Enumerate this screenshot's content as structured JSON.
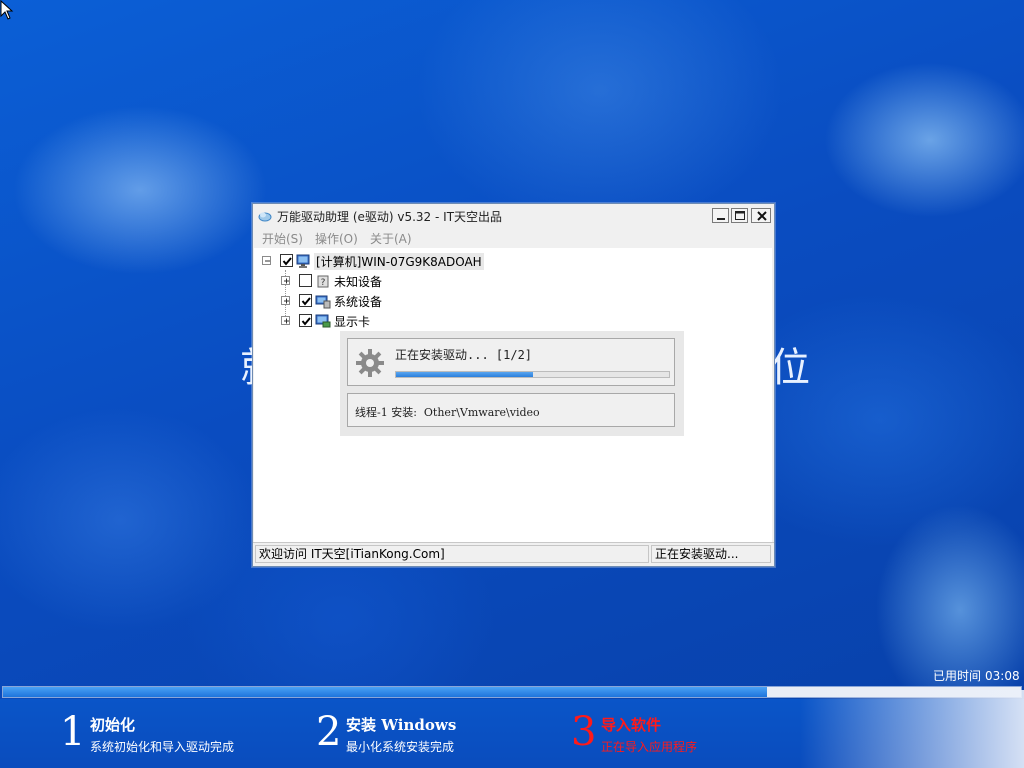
{
  "desktop": {
    "heading_left_fragment": "就",
    "heading_right_fragment": "位"
  },
  "window": {
    "title": "万能驱动助理 (e驱动) v5.32 - IT天空出品",
    "menu": [
      "开始(S)",
      "操作(O)",
      "关于(A)"
    ],
    "tree": {
      "root": {
        "label": "[计算机]WIN-07G9K8ADOAH",
        "checked": true
      },
      "children": [
        {
          "label": "未知设备",
          "checked": false
        },
        {
          "label": "系统设备",
          "checked": true
        },
        {
          "label": "显示卡",
          "checked": true
        }
      ]
    },
    "progress": {
      "text": "正在安装驱动... [1/2]",
      "fraction": 0.5,
      "thread_text": "线程-1 安装:  Other\\Vmware\\video"
    },
    "status": {
      "left": "欢迎访问 IT天空[iTianKong.Com]",
      "right": "正在安装驱动..."
    }
  },
  "install": {
    "elapsed_label": "已用时间",
    "elapsed_time": "03:08",
    "overall_fraction": 0.75,
    "steps": [
      {
        "num": "1",
        "title": "初始化",
        "subtitle": "系统初始化和导入驱动完成"
      },
      {
        "num": "2",
        "title": "安装 Windows",
        "subtitle": "最小化系统安装完成"
      },
      {
        "num": "3",
        "title": "导入软件",
        "subtitle": "正在导入应用程序"
      }
    ],
    "active_color": "#ff1a1a"
  },
  "icons": {
    "app": "cloud-icon",
    "gear": "gear-icon",
    "computer": "computer-icon",
    "unknown_device": "unknown-device-icon",
    "system_device": "system-device-icon",
    "display_card": "display-card-icon",
    "cursor": "mouse-cursor-icon"
  }
}
